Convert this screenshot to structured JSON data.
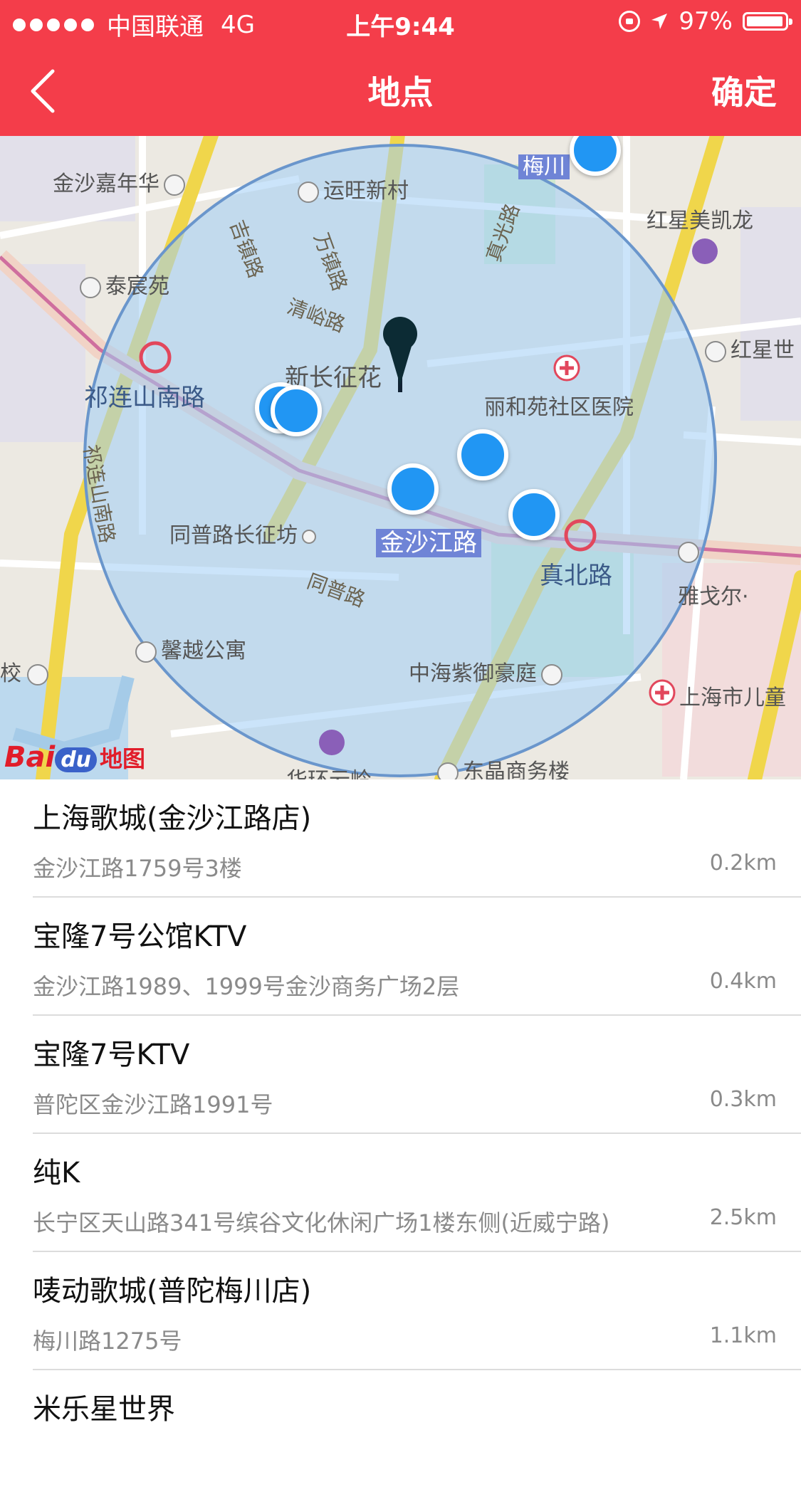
{
  "status_bar": {
    "carrier": "中国联通",
    "network": "4G",
    "time": "上午9:44",
    "battery": "97%"
  },
  "nav": {
    "title": "地点",
    "confirm_label": "确定"
  },
  "map": {
    "labels": {
      "jinsha_carnival": "金沙嘉年华",
      "yunwang": "运旺新村",
      "meichuan": "梅川",
      "hongxing_meikailong": "红星美凯龙",
      "taichen": "泰宸苑",
      "jizhen_rd": "吉镇路",
      "wanzhen_rd": "万镇路",
      "qingyu_rd": "清峪路",
      "zhenguang_rd": "真光路",
      "hongxingshi": "红星世",
      "xinchangzheng": "新长征花",
      "qilianshan_s_rd": "祁连山南路",
      "lihe_hospital": "丽和苑社区医院",
      "qilianshan_rd_v": "祁连山南路",
      "tongpu_changzheng": "同普路长征坊",
      "jinshajiang_rd": "金沙江路",
      "zhenbei_rd": "真北路",
      "yageer": "雅戈尔·",
      "tongpu_rd": "同普路",
      "xinyue": "馨越公寓",
      "school": "校",
      "zhonghai": "中海紫御豪庭",
      "childrens_hospital": "上海市儿童",
      "huahuan": "华环云岭",
      "dongjing": "东晶商务楼",
      "logo_bai": "Bai",
      "logo_du": "du",
      "logo_ditu": "地图"
    }
  },
  "places": [
    {
      "name": "上海歌城(金沙江路店)",
      "address": "金沙江路1759号3楼",
      "distance": "0.2km"
    },
    {
      "name": "宝隆7号公馆KTV",
      "address": "金沙江路1989、1999号金沙商务广场2层",
      "distance": "0.4km"
    },
    {
      "name": "宝隆7号KTV",
      "address": "普陀区金沙江路1991号",
      "distance": "0.3km"
    },
    {
      "name": "纯K",
      "address": "长宁区天山路341号缤谷文化休闲广场1楼东侧(近威宁路)",
      "distance": "2.5km"
    },
    {
      "name": "唛动歌城(普陀梅川店)",
      "address": "梅川路1275号",
      "distance": "1.1km"
    },
    {
      "name": "米乐星世界",
      "address": "",
      "distance": ""
    }
  ]
}
